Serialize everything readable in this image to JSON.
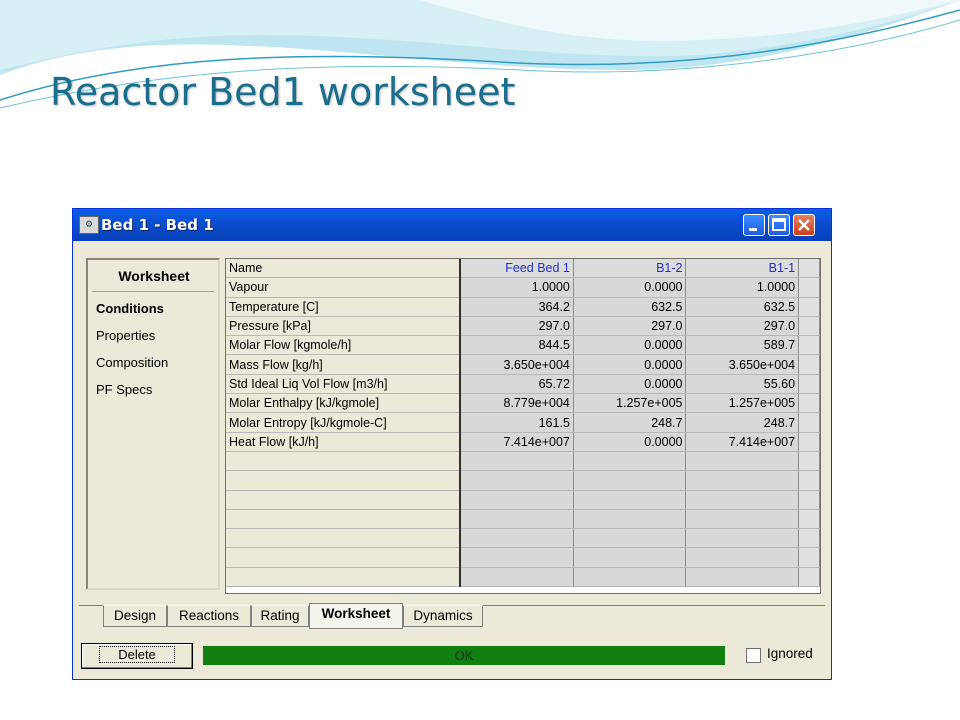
{
  "slide": {
    "title": "Reactor Bed1 worksheet",
    "colors": {
      "title": "#1a6e8c",
      "wave_light": "#bfe6f0",
      "wave_dark": "#2f9dc2"
    }
  },
  "window": {
    "title": "Bed 1 - Bed 1",
    "icon": "hysys-app-icon",
    "controls": [
      "minimize-icon",
      "maximize-icon",
      "close-icon"
    ]
  },
  "nav": {
    "header": "Worksheet",
    "items": [
      {
        "label": "Conditions",
        "active": true
      },
      {
        "label": "Properties",
        "active": false
      },
      {
        "label": "Composition",
        "active": false
      },
      {
        "label": "PF Specs",
        "active": false
      }
    ]
  },
  "table": {
    "header": {
      "name": "Name",
      "columns": [
        "Feed Bed 1",
        "B1-2",
        "B1-1"
      ]
    },
    "rows": [
      {
        "name": "Vapour",
        "values": [
          "1.0000",
          "0.0000",
          "1.0000"
        ]
      },
      {
        "name": "Temperature [C]",
        "values": [
          "364.2",
          "632.5",
          "632.5"
        ]
      },
      {
        "name": "Pressure [kPa]",
        "values": [
          "297.0",
          "297.0",
          "297.0"
        ]
      },
      {
        "name": "Molar Flow [kgmole/h]",
        "values": [
          "844.5",
          "0.0000",
          "589.7"
        ]
      },
      {
        "name": "Mass Flow [kg/h]",
        "values": [
          "3.650e+004",
          "0.0000",
          "3.650e+004"
        ]
      },
      {
        "name": "Std Ideal Liq Vol Flow [m3/h]",
        "values": [
          "65.72",
          "0.0000",
          "55.60"
        ]
      },
      {
        "name": "Molar Enthalpy [kJ/kgmole]",
        "values": [
          "8.779e+004",
          "1.257e+005",
          "1.257e+005"
        ]
      },
      {
        "name": "Molar Entropy [kJ/kgmole-C]",
        "values": [
          "161.5",
          "248.7",
          "248.7"
        ]
      },
      {
        "name": "Heat Flow [kJ/h]",
        "values": [
          "7.414e+007",
          "0.0000",
          "7.414e+007"
        ]
      }
    ],
    "empty_rows": 7
  },
  "tabs": [
    {
      "label": "Design",
      "active": false
    },
    {
      "label": "Reactions",
      "active": false
    },
    {
      "label": "Rating",
      "active": false
    },
    {
      "label": "Worksheet",
      "active": true
    },
    {
      "label": "Dynamics",
      "active": false
    }
  ],
  "footer": {
    "delete_label": "Delete",
    "status": "OK",
    "status_color": "#118011",
    "ignored_label": "Ignored",
    "ignored_checked": false
  }
}
